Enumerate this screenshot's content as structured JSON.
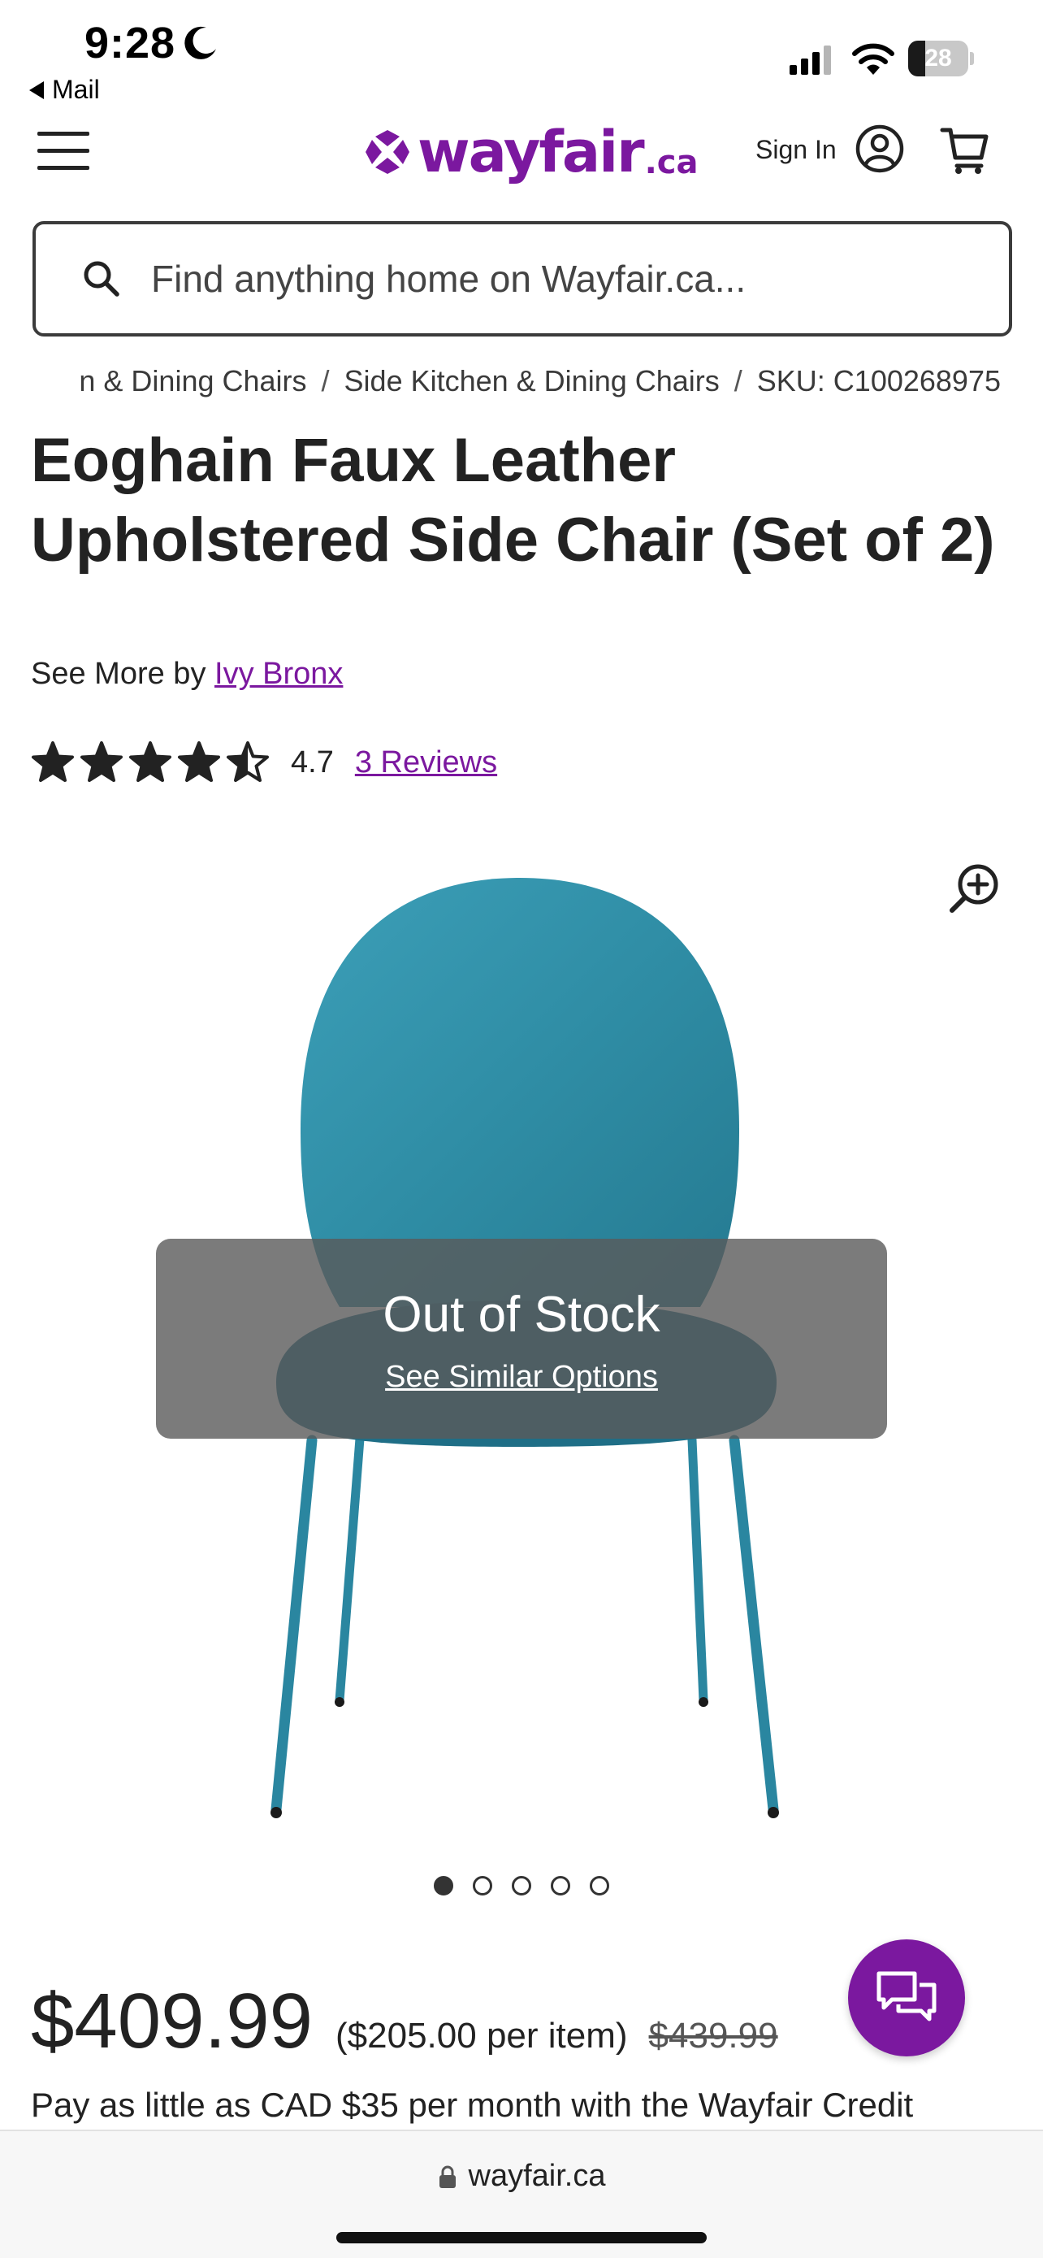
{
  "status_bar": {
    "time": "9:28",
    "back_app": "Mail",
    "battery_percent": "28",
    "battery_level": 0.28
  },
  "header": {
    "logo_text": "wayfair",
    "logo_tld": ".ca",
    "sign_in": "Sign In"
  },
  "search": {
    "placeholder": "Find anything home on Wayfair.ca..."
  },
  "breadcrumb": {
    "items": [
      "n & Dining Chairs",
      "Side Kitchen & Dining Chairs",
      "SKU: C100268975"
    ],
    "separator": "/"
  },
  "product": {
    "title": "Eoghain Faux Leather Upholstered Side Chair (Set of 2)",
    "see_more_prefix": "See More by",
    "brand": "Ivy Bronx",
    "rating": "4.7",
    "rating_value": 4.7,
    "reviews_link": "3 Reviews",
    "out_of_stock": "Out of Stock",
    "similar_link": "See Similar Options",
    "image_count": 5,
    "active_image": 1,
    "price": "$409.99",
    "per_item": "($205.00 per item)",
    "original_price": "$439.99",
    "credit_text": "Pay as little as CAD $35 per month with the Wayfair Credit"
  },
  "browser": {
    "url": "wayfair.ca"
  },
  "colors": {
    "brand_purple": "#7b189f",
    "chair_teal": "#2f8da5"
  }
}
